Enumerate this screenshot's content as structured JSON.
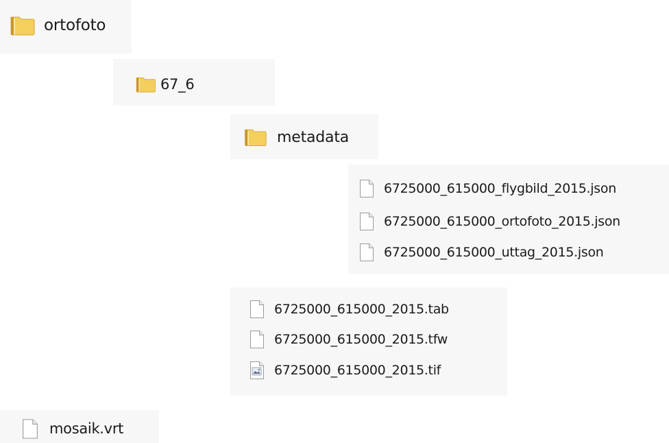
{
  "tree": {
    "root_folder": {
      "name": "ortofoto",
      "icon": "folder-icon"
    },
    "subfolder": {
      "name": "67_6",
      "icon": "folder-icon"
    },
    "metadata_folder": {
      "name": "metadata",
      "icon": "folder-icon"
    },
    "metadata_files": [
      {
        "name": "6725000_615000_flygbild_2015.json",
        "icon": "file-icon"
      },
      {
        "name": "6725000_615000_ortofoto_2015.json",
        "icon": "file-icon"
      },
      {
        "name": "6725000_615000_uttag_2015.json",
        "icon": "file-icon"
      }
    ],
    "tile_files": [
      {
        "name": "6725000_615000_2015.tab",
        "icon": "file-icon"
      },
      {
        "name": "6725000_615000_2015.tfw",
        "icon": "file-icon"
      },
      {
        "name": "6725000_615000_2015.tif",
        "icon": "image-file-icon"
      }
    ],
    "root_file": {
      "name": "mosaik.vrt",
      "icon": "file-icon"
    }
  },
  "colors": {
    "panel_background": "#f7f7f7",
    "folder_yellow": "#f3cf5b",
    "folder_dark": "#c8962c",
    "file_border": "#9a9a9a"
  }
}
